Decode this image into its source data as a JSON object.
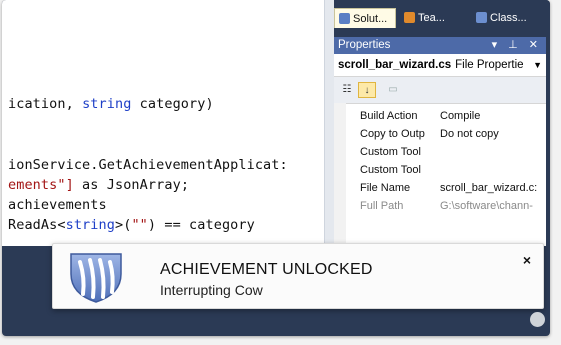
{
  "editor": {
    "lines": [
      {
        "pre": "ication, ",
        "kw": "string",
        "post": " category)"
      },
      {
        "text": "ionService.GetAchievementApplicat:"
      },
      {
        "str": "ements\"]",
        "mid": " as ",
        "type": "JsonArray",
        "post": ";"
      },
      {
        "text": "achievements"
      },
      {
        "pre": "ReadAs<",
        "kw": "string",
        "mid": ">(",
        "str": "\"\"",
        "post": ") == category"
      }
    ]
  },
  "tabs": [
    {
      "label": "Solut...",
      "icon_color": "#5b7fc4"
    },
    {
      "label": "Tea...",
      "icon_color": "#e08a2c"
    },
    {
      "label": "Class...",
      "icon_color": "#6c8fd0"
    }
  ],
  "properties": {
    "title": "Properties",
    "window_controls": "▾ ⊥ ✕",
    "object_name": "scroll_bar_wizard.cs",
    "object_type": "File Propertie",
    "rows": [
      {
        "name": "Build Action",
        "value": "Compile",
        "dim": false
      },
      {
        "name": "Copy to Outp",
        "value": "Do not copy",
        "dim": false
      },
      {
        "name": "Custom Tool",
        "value": "",
        "dim": false
      },
      {
        "name": "Custom Tool",
        "value": "",
        "dim": false
      },
      {
        "name": "File Name",
        "value": "scroll_bar_wizard.c:",
        "dim": false
      },
      {
        "name": "Full Path",
        "value": "G:\\software\\chann-",
        "dim": true
      }
    ]
  },
  "toast": {
    "title": "ACHIEVEMENT UNLOCKED",
    "subtitle": "Interrupting Cow",
    "close": "×",
    "icon": "claw-shield-icon"
  },
  "colors": {
    "chrome": "#2b3a55",
    "props_header": "#4d6aa8",
    "keyword": "#1e3fc7",
    "string": "#a31515",
    "type": "#2b91af"
  }
}
